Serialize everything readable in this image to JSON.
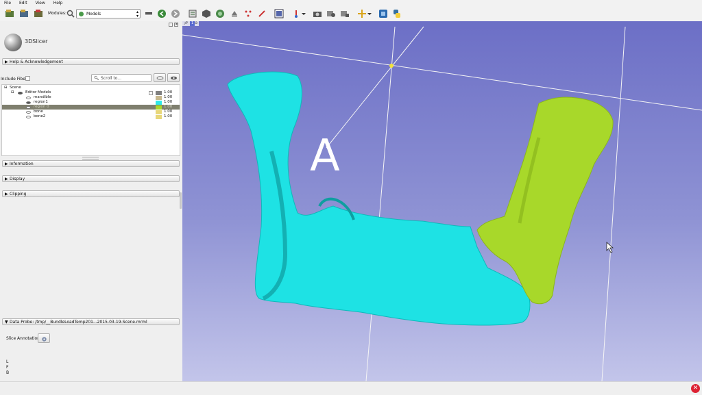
{
  "menu": [
    "File",
    "Edit",
    "View",
    "Help"
  ],
  "toolbar": {
    "modules_label": "Modules:",
    "module_selected": "Models"
  },
  "panel": {
    "logo_text": "3DSlicer",
    "help_section": "Help & Acknowledgement",
    "include_fibers_label": "Include Fibers",
    "scroll_placeholder": "Scroll to...",
    "tree": {
      "root": "Scene",
      "group": "Editor Models",
      "items": [
        {
          "name": "mandible",
          "opacity": "1.00",
          "color": "#c8b98f",
          "visible": false,
          "selected": false
        },
        {
          "name": "region1",
          "opacity": "1.00",
          "color": "#2ee8e8",
          "visible": true,
          "selected": false
        },
        {
          "name": "region 0",
          "opacity": "1.00",
          "color": "#a9d62a",
          "visible": false,
          "selected": true
        },
        {
          "name": "bone",
          "opacity": "1.00",
          "color": "#e8d77a",
          "visible": false,
          "selected": false
        },
        {
          "name": "bone2",
          "opacity": "1.00",
          "color": "#e8d77a",
          "visible": false,
          "selected": false
        }
      ],
      "group_opacity": "1.00",
      "group_color": "#808080"
    },
    "sections": [
      "Information",
      "Display",
      "Clipping"
    ],
    "data_probe": "Data Probe: /tmp/__BundleLoadTemp201...2015-03-19-Scene.mrml",
    "slice_annotations_label": "Slice Annotations:",
    "probe_letters": [
      "L",
      "F",
      "B"
    ]
  },
  "viewport": {
    "tab_label": "1",
    "annotation_letter": "A"
  }
}
